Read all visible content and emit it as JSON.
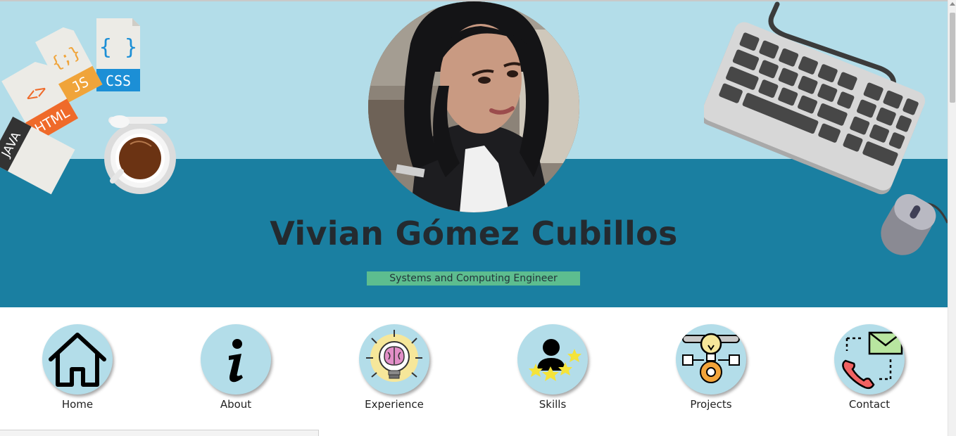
{
  "hero": {
    "name": "Vivian Gómez Cubillos",
    "subtitle": "Systems and Computing Engineer",
    "photo_icon": "profile-photo",
    "decorations": {
      "left": [
        "html-file-icon",
        "js-file-icon",
        "css-file-icon",
        "java-file-icon",
        "coffee-cup-icon"
      ],
      "right": [
        "keyboard-icon",
        "mouse-icon"
      ],
      "file_labels": {
        "css": "CSS",
        "js": "JS",
        "html": "HTML",
        "java": "JAVA",
        "css_glyph": "{ }",
        "js_glyph": "{;}",
        "html_glyph": "<>"
      }
    }
  },
  "nav": {
    "items": [
      {
        "label": "Home",
        "icon": "home-icon"
      },
      {
        "label": "About",
        "icon": "info-icon"
      },
      {
        "label": "Experience",
        "icon": "brain-lightbulb-icon"
      },
      {
        "label": "Skills",
        "icon": "person-stars-icon"
      },
      {
        "label": "Projects",
        "icon": "lightbulb-gear-icon"
      },
      {
        "label": "Contact",
        "icon": "phone-envelope-icon"
      }
    ]
  },
  "colors": {
    "hero_light": "#b3dde9",
    "hero_dark": "#1a7fa1",
    "subtitle_bg": "#5dbd8f",
    "name_text": "#242a2f",
    "nav_circle": "#b3dde9"
  }
}
